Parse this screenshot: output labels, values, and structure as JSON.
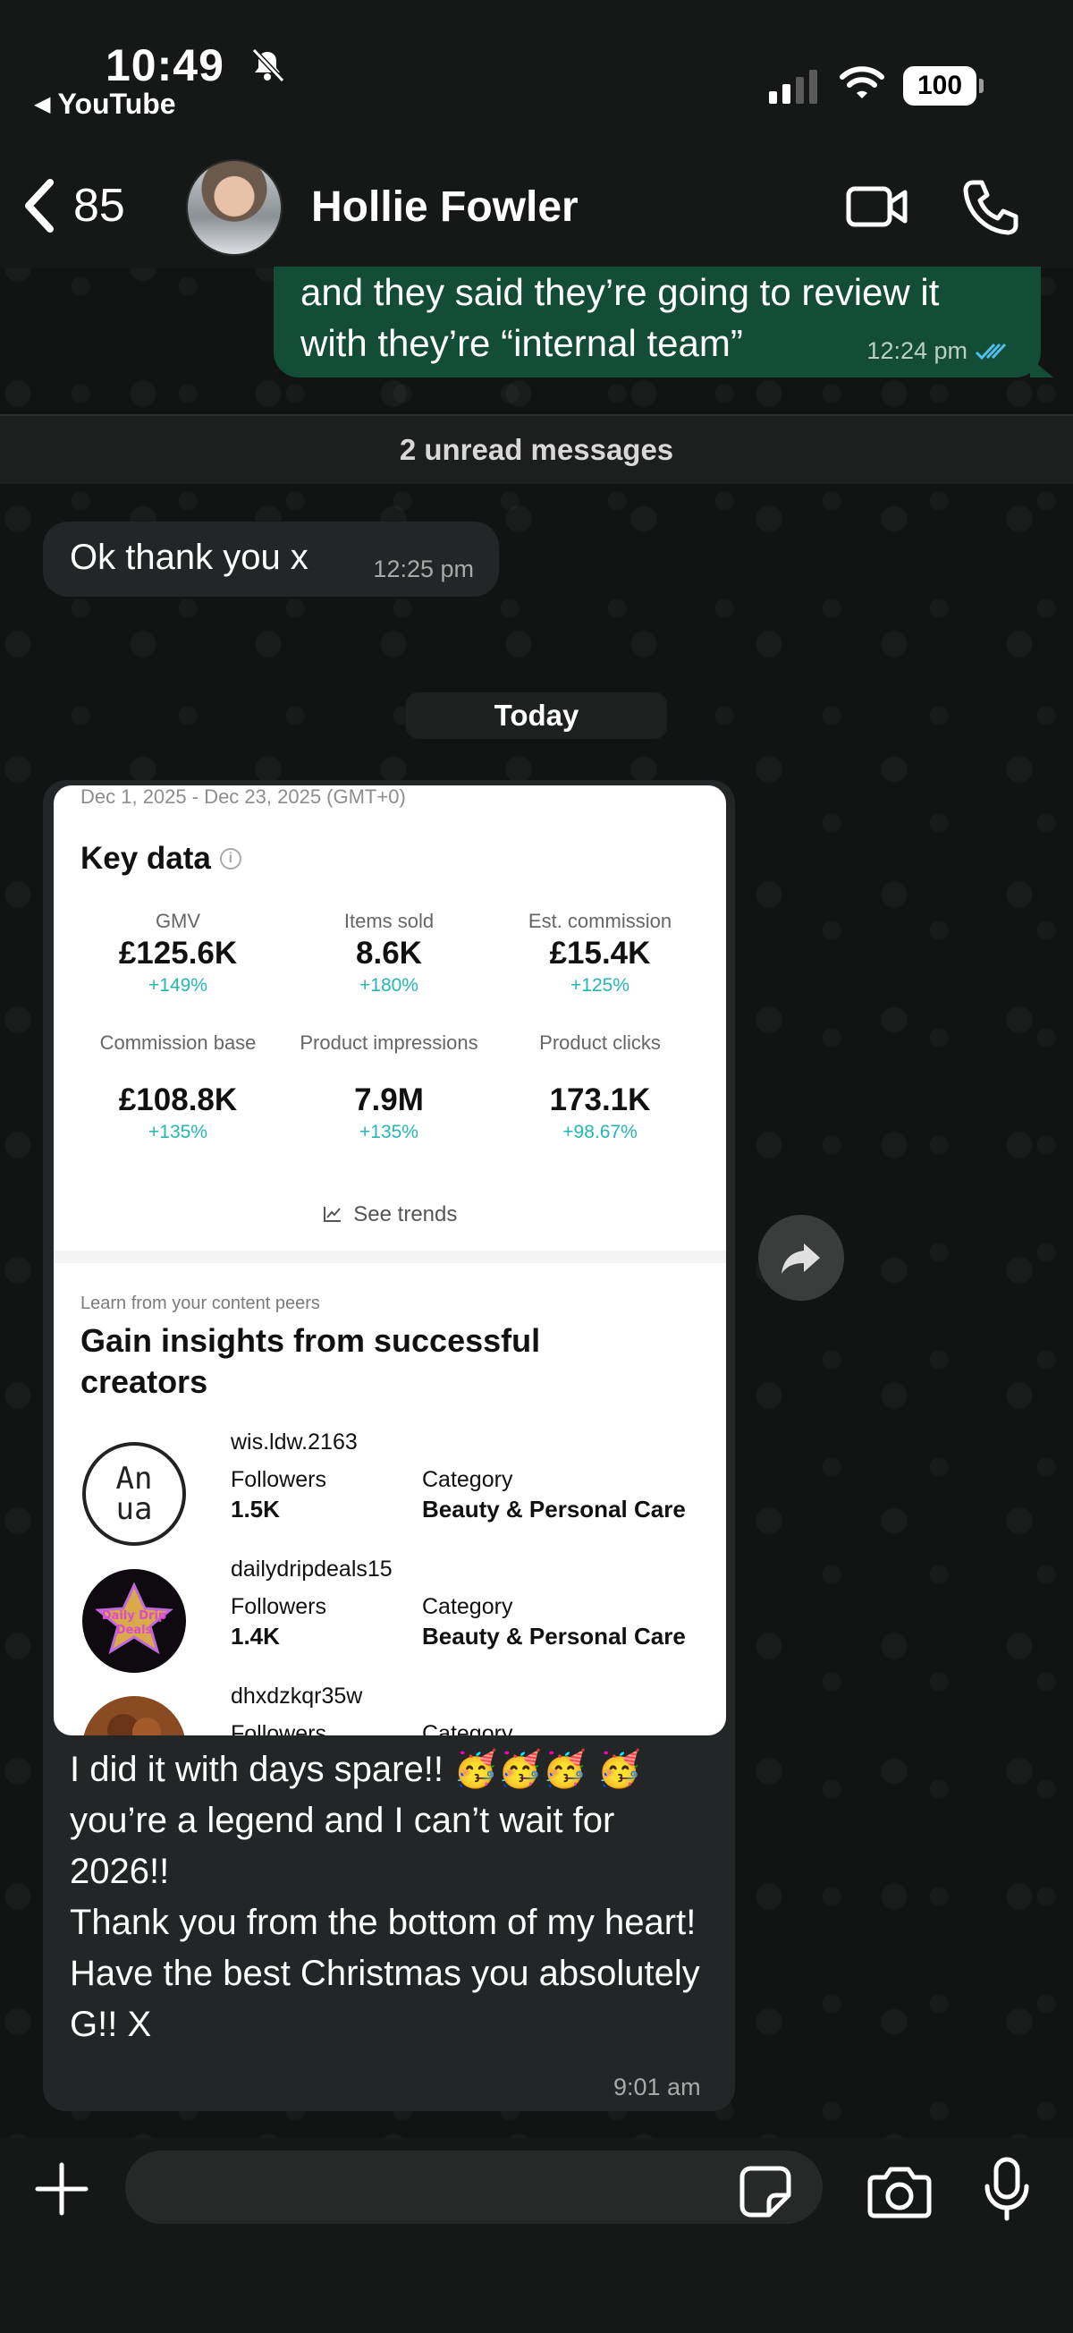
{
  "status_bar": {
    "time": "10:49",
    "back_app": "YouTube",
    "battery": "100"
  },
  "header": {
    "back_count": "85",
    "contact_name": "Hollie Fowler"
  },
  "messages": {
    "outgoing_text": "and they said they’re going to review it with they’re “internal team”",
    "outgoing_time": "12:24 pm",
    "unread_banner": "2 unread messages",
    "incoming_text": "Ok thank you x",
    "incoming_time": "12:25 pm",
    "date_chip": "Today",
    "caption_text": "I did it with days spare!! 🥳🥳🥳 🥳 you’re a legend and I can’t wait for 2026!!\nThank you from the bottom of my heart!\nHave the best Christmas you absolutely G!! X",
    "caption_time": "9:01 am"
  },
  "screenshot": {
    "date_range": "Dec 1, 2025 - Dec 23, 2025 (GMT+0)",
    "key_data_title": "Key data",
    "metrics": [
      {
        "label": "GMV",
        "value": "£125.6K",
        "change": "+149%"
      },
      {
        "label": "Items sold",
        "value": "8.6K",
        "change": "+180%"
      },
      {
        "label": "Est. commission",
        "value": "£15.4K",
        "change": "+125%"
      },
      {
        "label": "Commission base",
        "value": "£108.8K",
        "change": "+135%"
      },
      {
        "label": "Product impressions",
        "value": "7.9M",
        "change": "+135%"
      },
      {
        "label": "Product clicks",
        "value": "173.1K",
        "change": "+98.67%"
      }
    ],
    "see_trends": "See trends",
    "peers_subtitle": "Learn from your content peers",
    "peers_title": "Gain insights from successful creators",
    "creators": [
      {
        "handle": "wis.ldw.2163",
        "followers_label": "Followers",
        "followers": "1.5K",
        "category_label": "Category",
        "category": "Beauty & Personal Care",
        "logo_text": "An ua"
      },
      {
        "handle": "dailydripdeals15",
        "followers_label": "Followers",
        "followers": "1.4K",
        "category_label": "Category",
        "category": "Beauty & Personal Care",
        "logo_text": "Daily Drip Deals"
      },
      {
        "handle": "dhxdzkqr35w",
        "followers_label": "Followers",
        "followers": "",
        "category_label": "Category",
        "category": ""
      }
    ]
  },
  "colors": {
    "outgoing_bubble": "#134d37",
    "incoming_bubble": "#232626",
    "accent_change": "#25b7b3",
    "read_ticks": "#53bdeb"
  },
  "icons": [
    "bell-slash-icon",
    "signal-icon",
    "wifi-icon",
    "chevron-left-icon",
    "video-call-icon",
    "phone-icon",
    "info-icon",
    "trend-chart-icon",
    "forward-icon",
    "plus-icon",
    "sticker-icon",
    "camera-icon",
    "mic-icon",
    "double-check-icon"
  ]
}
